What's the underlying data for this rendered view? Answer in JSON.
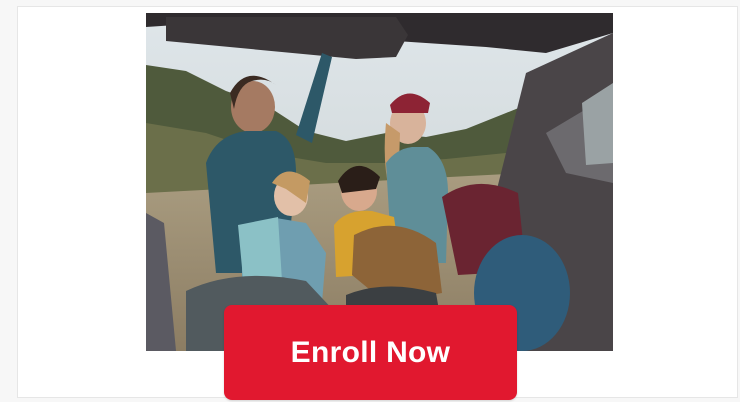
{
  "promo": {
    "image_subject": "family-loading-car-trunk-photo",
    "cta_label": "Enroll Now"
  },
  "colors": {
    "cta_background": "#e1182f",
    "cta_text": "#ffffff"
  }
}
